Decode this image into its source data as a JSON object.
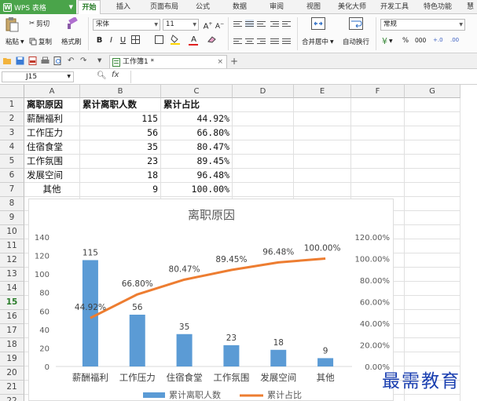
{
  "app": {
    "name": "WPS 表格",
    "logo": "W"
  },
  "tabs": [
    "开始",
    "插入",
    "页面布局",
    "公式",
    "数据",
    "审阅",
    "视图",
    "美化大师",
    "开发工具",
    "特色功能",
    "慧"
  ],
  "ribbon": {
    "paste": "粘贴",
    "cut": "剪切",
    "copy": "复制",
    "format_painter": "格式刷",
    "font_name": "宋体",
    "font_size": "11",
    "merge_center": "合并居中",
    "wrap_text": "自动换行",
    "number_format": "常规",
    "percent": "%",
    "thousands": "000"
  },
  "document": {
    "tab_title": "工作簿1 *"
  },
  "formula_bar": {
    "name_box": "J15",
    "fx": "fx",
    "value": ""
  },
  "sheet": {
    "columns": [
      "A",
      "B",
      "C",
      "D",
      "E",
      "F",
      "G"
    ],
    "rows": [
      "1",
      "2",
      "3",
      "4",
      "5",
      "6",
      "7",
      "8",
      "9",
      "10",
      "11",
      "12",
      "13",
      "14",
      "15",
      "16",
      "17",
      "18",
      "19",
      "20",
      "21",
      "22"
    ],
    "selected_row": "15",
    "headers": [
      "离职原因",
      "累计离职人数",
      "累计占比"
    ],
    "data": [
      [
        "薪酬福利",
        "115",
        "44.92%"
      ],
      [
        "工作压力",
        "56",
        "66.80%"
      ],
      [
        "住宿食堂",
        "35",
        "80.47%"
      ],
      [
        "工作氛围",
        "23",
        "89.45%"
      ],
      [
        "发展空间",
        "18",
        "96.48%"
      ],
      [
        "其他",
        "9",
        "100.00%"
      ]
    ]
  },
  "chart_data": {
    "type": "bar",
    "title": "离职原因",
    "categories": [
      "薪酬福利",
      "工作压力",
      "住宿食堂",
      "工作氛围",
      "发展空间",
      "其他"
    ],
    "series": [
      {
        "name": "累计离职人数",
        "type": "bar",
        "axis": "left",
        "values": [
          115,
          56,
          35,
          23,
          18,
          9
        ],
        "labels": [
          "115",
          "56",
          "35",
          "23",
          "18",
          "9"
        ],
        "color": "#5b9bd5"
      },
      {
        "name": "累计占比",
        "type": "line",
        "axis": "right",
        "values": [
          44.92,
          66.8,
          80.47,
          89.45,
          96.48,
          100.0
        ],
        "labels": [
          "44.92%",
          "66.80%",
          "80.47%",
          "89.45%",
          "96.48%",
          "100.00%"
        ],
        "color": "#ed7d31"
      }
    ],
    "y_left": {
      "range": [
        0,
        140
      ],
      "ticks": [
        "0",
        "20",
        "40",
        "60",
        "80",
        "100",
        "120",
        "140"
      ]
    },
    "y_right": {
      "range": [
        0,
        120
      ],
      "ticks": [
        "0.00%",
        "20.00%",
        "40.00%",
        "60.00%",
        "80.00%",
        "100.00%",
        "120.00%"
      ]
    },
    "legend_position": "bottom",
    "grid": false
  },
  "watermark": "最需教育",
  "colors": {
    "accent": "#4aa44a",
    "bar": "#5b9bd5",
    "line": "#ed7d31",
    "watermark": "#1a3fb0"
  }
}
